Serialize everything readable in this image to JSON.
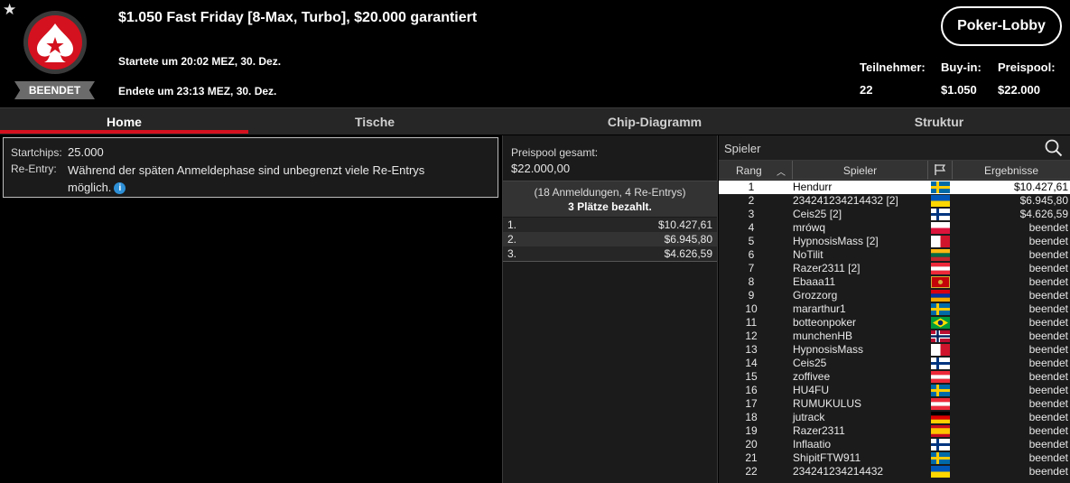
{
  "header": {
    "title": "$1.050 Fast Friday [8-Max, Turbo], $20.000 garantiert",
    "started": "Startete um 20:02 MEZ, 30. Dez.",
    "ended": "Endete um 23:13 MEZ, 30. Dez.",
    "status": "BEENDET",
    "lobby_button": "Poker-Lobby",
    "stats": {
      "participants_label": "Teilnehmer:",
      "participants_value": "22",
      "buyin_label": "Buy-in:",
      "buyin_value": "$1.050",
      "prizepool_label": "Preispool:",
      "prizepool_value": "$22.000"
    },
    "brand_color": "#d4111e"
  },
  "tabs": [
    {
      "label": "Home",
      "active": true
    },
    {
      "label": "Tische",
      "active": false
    },
    {
      "label": "Chip-Diagramm",
      "active": false
    },
    {
      "label": "Struktur",
      "active": false
    }
  ],
  "info": {
    "startchips_label": "Startchips:",
    "startchips_value": "25.000",
    "reentry_label": "Re-Entry:",
    "reentry_value": "Während der späten Anmeldephase sind unbegrenzt viele Re-Entrys möglich.",
    "info_icon": "i"
  },
  "prize": {
    "total_label": "Preispool gesamt:",
    "total_value": "$22.000,00",
    "entries_line": "(18 Anmeldungen, 4 Re-Entrys)",
    "paid_line": "3 Plätze bezahlt.",
    "payouts": [
      {
        "pos": "1.",
        "amount": "$10.427,61"
      },
      {
        "pos": "2.",
        "amount": "$6.945,80"
      },
      {
        "pos": "3.",
        "amount": "$4.626,59"
      }
    ]
  },
  "players": {
    "search_placeholder": "Spieler",
    "columns": {
      "rank": "Rang",
      "player": "Spieler",
      "result": "Ergebnisse"
    },
    "rows": [
      {
        "rank": "1",
        "name": "Hendurr",
        "flag": "sweden",
        "result": "$10.427,61"
      },
      {
        "rank": "2",
        "name": "234241234214432 [2]",
        "flag": "ukraine",
        "result": "$6.945,80"
      },
      {
        "rank": "3",
        "name": "Ceis25 [2]",
        "flag": "finland",
        "result": "$4.626,59"
      },
      {
        "rank": "4",
        "name": "mrówq",
        "flag": "poland",
        "result": "beendet"
      },
      {
        "rank": "5",
        "name": "HypnosisMass [2]",
        "flag": "malta",
        "result": "beendet"
      },
      {
        "rank": "6",
        "name": "NoTilit",
        "flag": "lithuania",
        "result": "beendet"
      },
      {
        "rank": "7",
        "name": "Razer2311 [2]",
        "flag": "austria",
        "result": "beendet"
      },
      {
        "rank": "8",
        "name": "Ebaaa11",
        "flag": "montenegro",
        "result": "beendet"
      },
      {
        "rank": "9",
        "name": "Grozzorg",
        "flag": "armenia",
        "result": "beendet"
      },
      {
        "rank": "10",
        "name": "mararthur1",
        "flag": "sweden",
        "result": "beendet"
      },
      {
        "rank": "11",
        "name": "botteonpoker",
        "flag": "brazil",
        "result": "beendet"
      },
      {
        "rank": "12",
        "name": "munchenHB",
        "flag": "norway",
        "result": "beendet"
      },
      {
        "rank": "13",
        "name": "HypnosisMass",
        "flag": "malta",
        "result": "beendet"
      },
      {
        "rank": "14",
        "name": "Ceis25",
        "flag": "finland",
        "result": "beendet"
      },
      {
        "rank": "15",
        "name": "zoffivee",
        "flag": "austria",
        "result": "beendet"
      },
      {
        "rank": "16",
        "name": "HU4FU",
        "flag": "sweden",
        "result": "beendet"
      },
      {
        "rank": "17",
        "name": "RUMUKULUS",
        "flag": "austria",
        "result": "beendet"
      },
      {
        "rank": "18",
        "name": "jutrack",
        "flag": "germany",
        "result": "beendet"
      },
      {
        "rank": "19",
        "name": "Razer2311",
        "flag": "spain",
        "result": "beendet"
      },
      {
        "rank": "20",
        "name": "Inflaatio",
        "flag": "finland",
        "result": "beendet"
      },
      {
        "rank": "21",
        "name": "ShipitFTW911",
        "flag": "sweden",
        "result": "beendet"
      },
      {
        "rank": "22",
        "name": "234241234214432",
        "flag": "ukraine",
        "result": "beendet"
      }
    ]
  }
}
